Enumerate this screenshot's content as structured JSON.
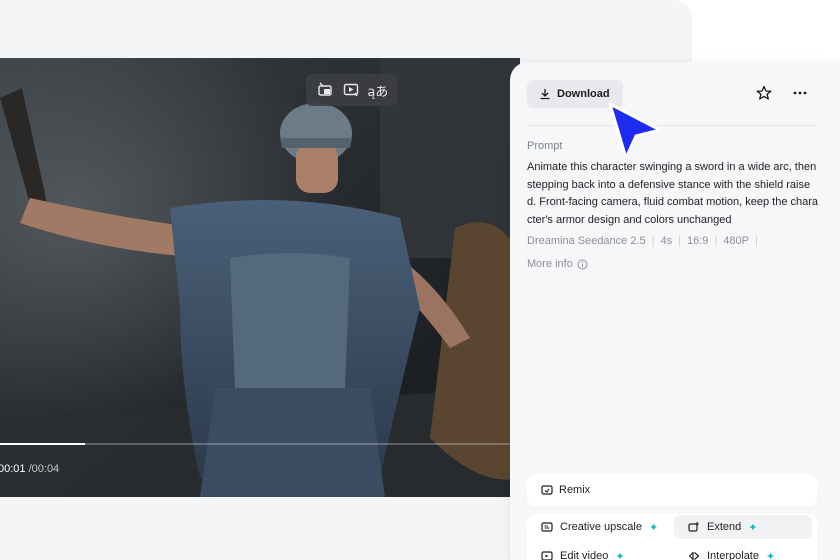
{
  "player": {
    "current_time": "00:01",
    "total_time": "/00:04",
    "progress_fraction": 0.163,
    "toolbar": [
      {
        "name": "pip-icon"
      },
      {
        "name": "play-frame-icon"
      },
      {
        "name": "translate-icon",
        "glyph": "ąあ"
      }
    ]
  },
  "panel": {
    "download_label": "Download",
    "prompt_label": "Prompt",
    "prompt_text": "Animate this character swinging a sword in a wide arc, then stepping back into a defensive stance with the shield raised. Front-facing camera, fluid combat motion, keep the character's armor design and colors unchanged",
    "meta": [
      "Dreamina Seedance 2.5",
      "4s",
      "16:9",
      "480P"
    ],
    "more_info": "More info",
    "remix": "Remix",
    "actions": {
      "upscale": "Creative upscale",
      "extend": "Extend",
      "edit": "Edit video",
      "interpolate": "Interpolate"
    }
  },
  "colors": {
    "accent_cursor": "#1e2bf0",
    "spark": "#14b8c8"
  }
}
